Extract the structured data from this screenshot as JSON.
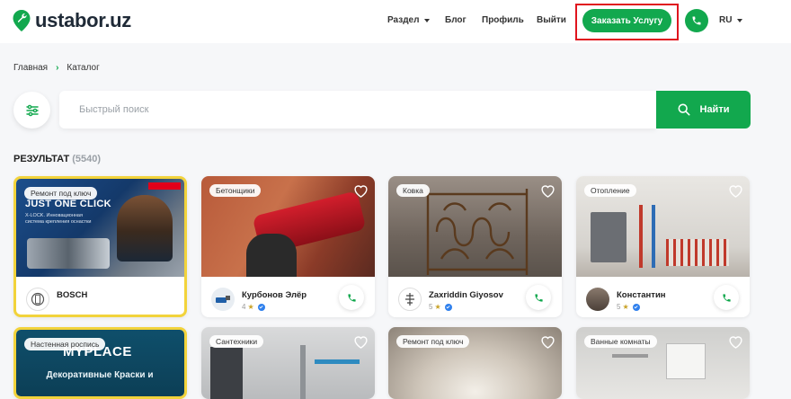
{
  "header": {
    "logo_text": "ustabor.uz",
    "nav": {
      "section": "Раздел",
      "blog": "Блог",
      "profile": "Профиль",
      "logout": "Выйти"
    },
    "order_button": "Заказать Услугу",
    "language": "RU"
  },
  "breadcrumb": {
    "home": "Главная",
    "catalog": "Каталог"
  },
  "search": {
    "placeholder": "Быстрый поиск",
    "button": "Найти"
  },
  "results": {
    "label": "РЕЗУЛЬТАТ",
    "count": "(5540)"
  },
  "cards": [
    {
      "tag": "Ремонт под ключ",
      "name": "BOSCH",
      "rating": "",
      "featured": true,
      "photo_text": "JUST ONE CLICK",
      "photo_subtext": "X-LOCK. Инновационная система крепления оснастки"
    },
    {
      "tag": "Бетонщики",
      "name": "Курбонов Элёр",
      "rating": "4",
      "featured": false
    },
    {
      "tag": "Ковка",
      "name": "Zaxriddin Giyosov",
      "rating": "5",
      "featured": false
    },
    {
      "tag": "Отопление",
      "name": "Константин",
      "rating": "5",
      "featured": false
    },
    {
      "tag": "Настенная роспись",
      "featured": true,
      "photo_text": "MYPLACE",
      "photo_subtext": "Декоративные Краски и"
    },
    {
      "tag": "Сантехники",
      "featured": false
    },
    {
      "tag": "Ремонт под ключ",
      "featured": false
    },
    {
      "tag": "Ванные комнаты",
      "featured": false
    }
  ],
  "colors": {
    "accent": "#12a84e",
    "highlight": "#e0141e",
    "featured_border": "#f2d33b",
    "verified": "#2f80ed"
  }
}
